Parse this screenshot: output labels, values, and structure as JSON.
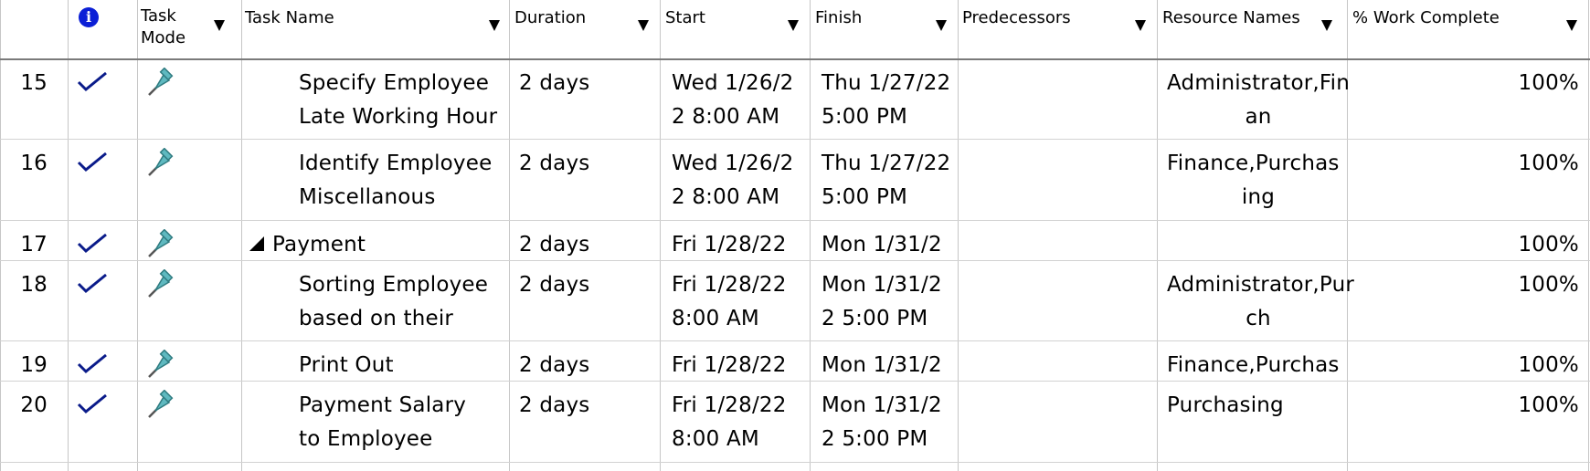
{
  "headers": {
    "info": "i",
    "task_mode": "Task Mode",
    "task_name": "Task Name",
    "duration": "Duration",
    "start": "Start",
    "finish": "Finish",
    "predecessors": "Predecessors",
    "resource_names": "Resource Names",
    "pct_work_complete": "% Work Complete"
  },
  "rows": [
    {
      "id": "15",
      "name1": "Specify Employee",
      "name2": "Late Working Hour",
      "duration": "2 days",
      "start1": "Wed 1/26/2",
      "start2": "2 8:00 AM",
      "finish1": "Thu 1/27/22",
      "finish2": "5:00 PM",
      "res1": "Administrator,Fin",
      "res2": "an",
      "pct": "100%"
    },
    {
      "id": "16",
      "name1": "Identify Employee",
      "name2": "Miscellanous",
      "duration": "2 days",
      "start1": "Wed 1/26/2",
      "start2": "2 8:00 AM",
      "finish1": "Thu 1/27/22",
      "finish2": "5:00 PM",
      "res1": "Finance,Purchas",
      "res2": "ing",
      "pct": "100%"
    },
    {
      "id": "17",
      "name1": "Payment",
      "name2": "",
      "duration": "2 days",
      "start1": "Fri 1/28/22",
      "start2": "",
      "finish1": "Mon 1/31/2",
      "finish2": "",
      "res1": "",
      "res2": "",
      "pct": "100%"
    },
    {
      "id": "18",
      "name1": "Sorting Employee",
      "name2": "based on their",
      "duration": "2 days",
      "start1": "Fri 1/28/22",
      "start2": "8:00 AM",
      "finish1": "Mon 1/31/2",
      "finish2": "2 5:00 PM",
      "res1": "Administrator,Pur",
      "res2": "ch",
      "pct": "100%"
    },
    {
      "id": "19",
      "name1": "Print Out",
      "name2": "",
      "duration": "2 days",
      "start1": "Fri 1/28/22",
      "start2": "",
      "finish1": "Mon 1/31/2",
      "finish2": "",
      "res1": "Finance,Purchas",
      "res2": "",
      "pct": "100%"
    },
    {
      "id": "20",
      "name1": "Payment Salary",
      "name2": "to Employee",
      "duration": "2 days",
      "start1": "Fri 1/28/22",
      "start2": "8:00 AM",
      "finish1": "Mon 1/31/2",
      "finish2": "2 5:00 PM",
      "res1": "Purchasing",
      "res2": "",
      "pct": "100%"
    }
  ]
}
